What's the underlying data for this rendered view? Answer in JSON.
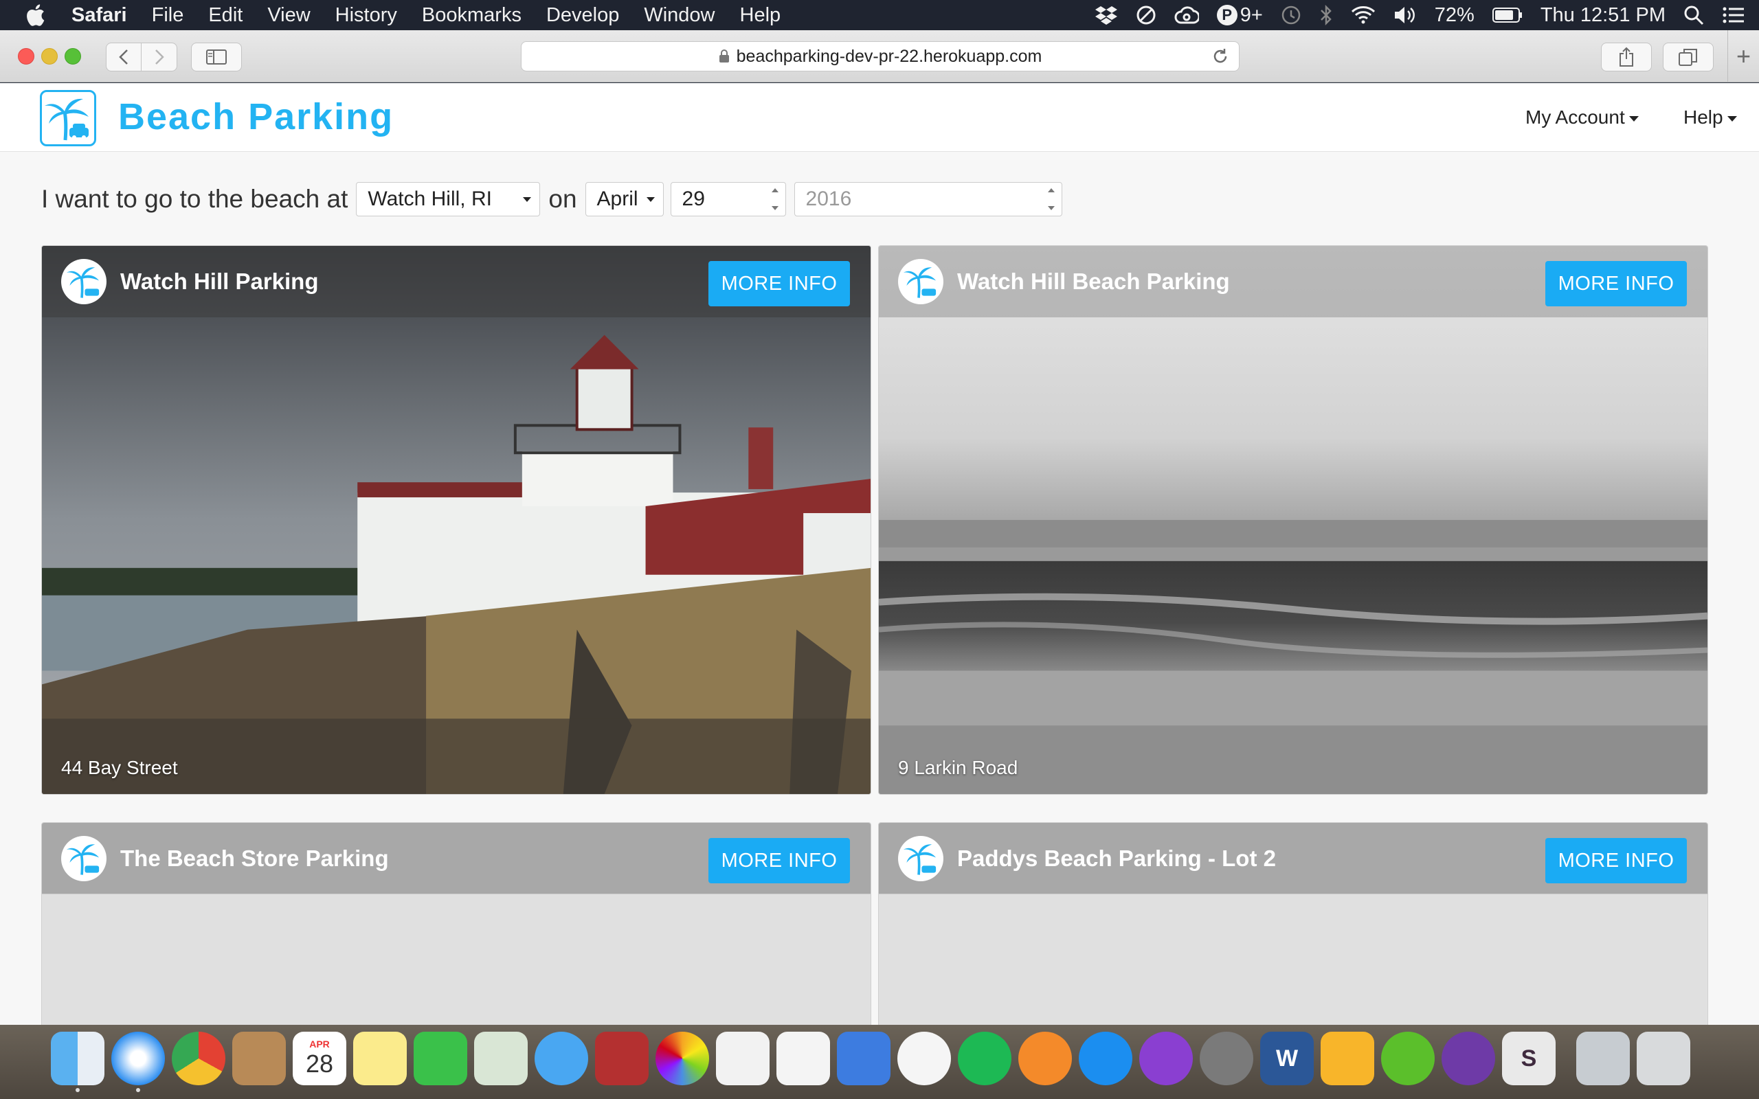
{
  "menubar": {
    "app_name": "Safari",
    "items": [
      "File",
      "Edit",
      "View",
      "History",
      "Bookmarks",
      "Develop",
      "Window",
      "Help"
    ],
    "status": {
      "p_badge": "P",
      "p_count": "9+",
      "battery": "72%",
      "clock": "Thu 12:51 PM"
    }
  },
  "browser": {
    "url": "beachparking-dev-pr-22.herokuapp.com",
    "new_tab_label": "+"
  },
  "site": {
    "title": "Beach Parking",
    "nav": {
      "account": "My Account",
      "help": "Help"
    },
    "search": {
      "prefix": "I want to go to the beach at",
      "location": "Watch Hill, RI",
      "on_label": "on",
      "month": "April",
      "day": "29",
      "year_placeholder": "2016"
    },
    "more_info_label": "MORE INFO",
    "cards": [
      {
        "title": "Watch Hill Parking",
        "address": "44 Bay Street"
      },
      {
        "title": "Watch Hill Beach Parking",
        "address": "9 Larkin Road"
      },
      {
        "title": "The Beach Store Parking",
        "address": ""
      },
      {
        "title": "Paddys Beach Parking - Lot 2",
        "address": ""
      }
    ]
  },
  "dock": {
    "calendar_month": "APR",
    "calendar_day": "28",
    "word_letter": "W",
    "slack_letter": "S"
  },
  "colors": {
    "brand": "#23b3f2",
    "button": "#1aabf4"
  }
}
